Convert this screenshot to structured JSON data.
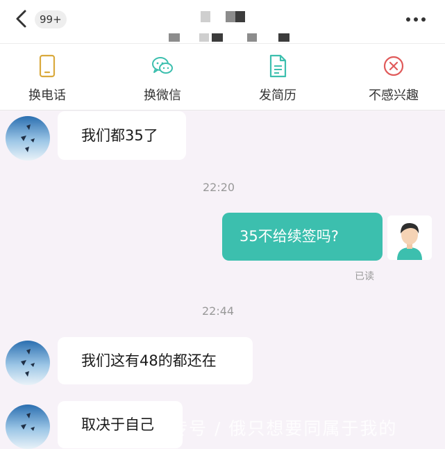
{
  "header": {
    "unread_badge": "99+",
    "back_icon": "chevron-left-icon",
    "more_icon": "more-dots-icon"
  },
  "actions": [
    {
      "label": "换电话",
      "icon": "phone-icon",
      "color": "#d9a93c"
    },
    {
      "label": "换微信",
      "icon": "wechat-icon",
      "color": "#3cbfae"
    },
    {
      "label": "发简历",
      "icon": "resume-icon",
      "color": "#3cbfae"
    },
    {
      "label": "不感兴趣",
      "icon": "close-circle-icon",
      "color": "#e05a5a"
    }
  ],
  "messages": {
    "m1": "我们都35了",
    "t1": "22:20",
    "m2": "35不给续签吗?",
    "m2_status": "已读",
    "t2": "22:44",
    "m3": "我们这有48的都还在",
    "m4": "取决于自己"
  },
  "watermark": "传号 / 俄只想要同属于我的",
  "colors": {
    "accent": "#3cbfae",
    "background": "#f7f2f8"
  }
}
